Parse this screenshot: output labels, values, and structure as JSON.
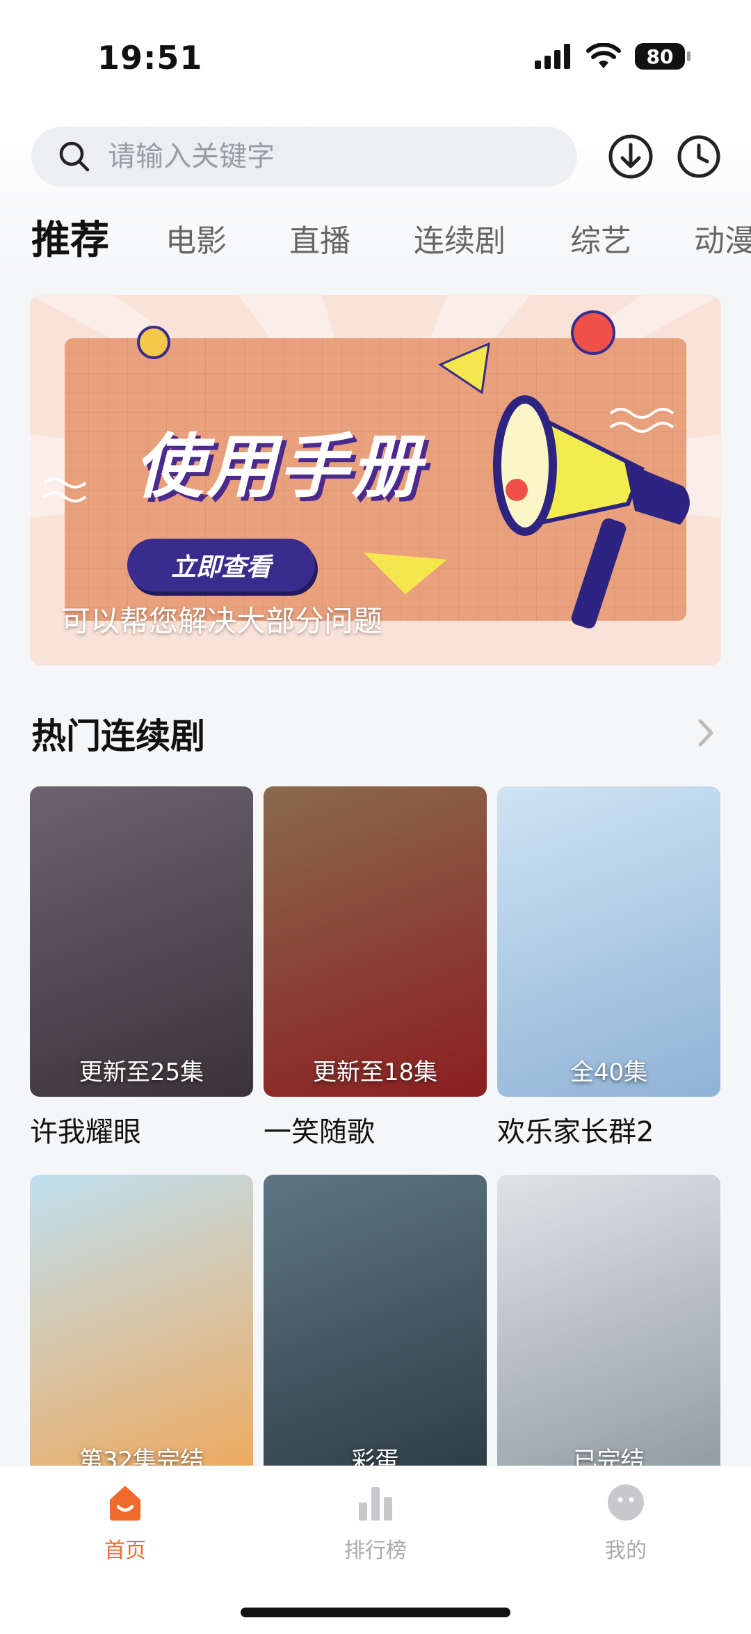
{
  "status_bar": {
    "time": "19:51",
    "battery": "80"
  },
  "search": {
    "placeholder": "请输入关键字"
  },
  "tabs": [
    {
      "label": "推荐",
      "active": true
    },
    {
      "label": "电影",
      "active": false
    },
    {
      "label": "直播",
      "active": false
    },
    {
      "label": "连续剧",
      "active": false
    },
    {
      "label": "综艺",
      "active": false
    },
    {
      "label": "动漫",
      "active": false
    }
  ],
  "banner": {
    "title": "使用手册",
    "button_label": "立即查看",
    "caption": "可以帮您解决大部分问题"
  },
  "section": {
    "title": "热门连续剧"
  },
  "dramas": [
    {
      "name": "许我耀眼",
      "badge": "更新至25集",
      "colors": [
        "#6d6270",
        "#3a3338"
      ]
    },
    {
      "name": "一笑随歌",
      "badge": "更新至18集",
      "colors": [
        "#8a6a4e",
        "#8b1e20"
      ]
    },
    {
      "name": "欢乐家长群2",
      "badge": "全40集",
      "colors": [
        "#cfe3f3",
        "#8fb3d6"
      ]
    },
    {
      "name": "",
      "badge": "第32集完结",
      "colors": [
        "#bfe0ef",
        "#f0a85a"
      ]
    },
    {
      "name": "",
      "badge": "彩蛋",
      "colors": [
        "#5e7682",
        "#2d3b42"
      ]
    },
    {
      "name": "",
      "badge": "已完结",
      "colors": [
        "#dfe3e6",
        "#8e9aa0"
      ]
    }
  ],
  "bottom_nav": [
    {
      "label": "首页",
      "icon": "home-icon",
      "active": true
    },
    {
      "label": "排行榜",
      "icon": "ranking-icon",
      "active": false
    },
    {
      "label": "我的",
      "icon": "profile-icon",
      "active": false
    }
  ],
  "colors": {
    "accent": "#f06a2c",
    "banner_button": "#3a2c8c"
  }
}
